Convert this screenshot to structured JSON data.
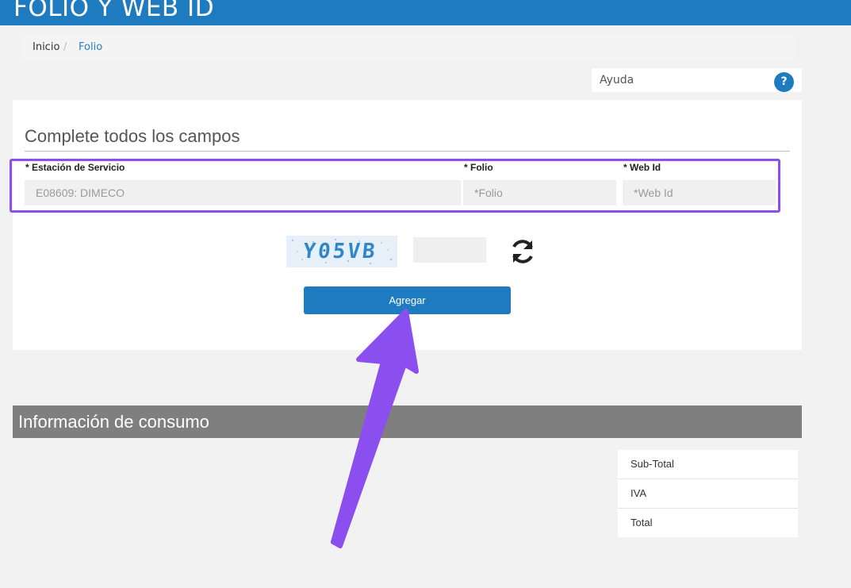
{
  "header": {
    "title": "FOLIO Y WEB ID"
  },
  "breadcrumb": {
    "home": "Inicio",
    "separator": "/",
    "current": "Folio"
  },
  "help": {
    "label": "Ayuda",
    "icon": "?"
  },
  "form": {
    "heading": "Complete todos los campos",
    "fields": [
      {
        "label": "* Estación de Servicio",
        "value": "E08609: DIMECO",
        "placeholder": ""
      },
      {
        "label": "* Folio",
        "value": "",
        "placeholder": "*Folio"
      },
      {
        "label": "* Web Id",
        "value": "",
        "placeholder": "*Web Id"
      }
    ],
    "captcha": {
      "text": "Y05VB"
    },
    "submit_label": "Agregar"
  },
  "info": {
    "title": "Información de consumo",
    "rows": [
      "Sub-Total",
      "IVA",
      "Total"
    ]
  },
  "colors": {
    "brand": "#1f7bc0",
    "highlight": "#8b4ff0",
    "info_bar": "#7f7f7f"
  }
}
